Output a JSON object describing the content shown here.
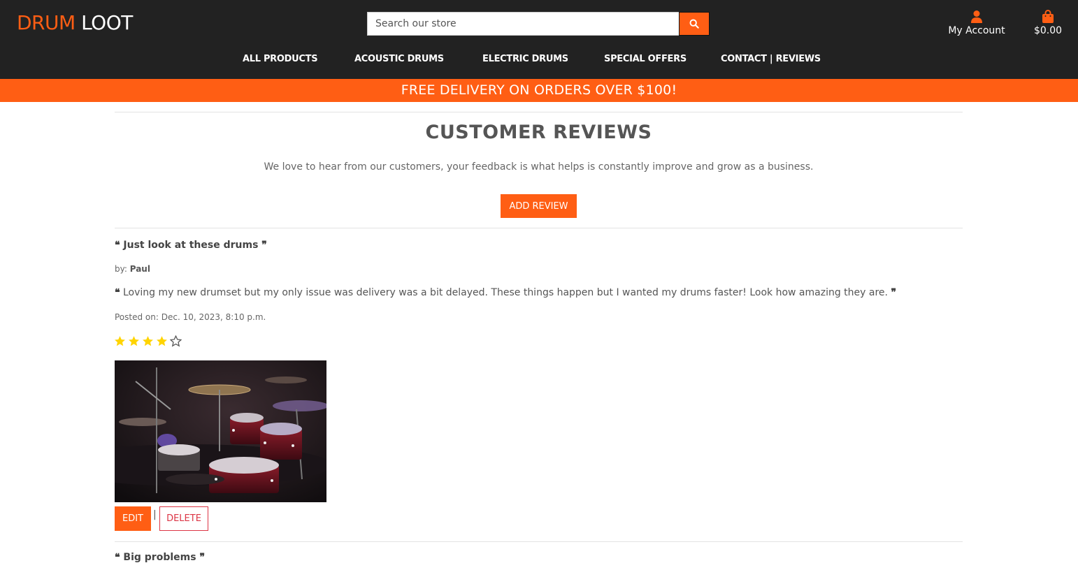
{
  "brand": {
    "part1": "DRUM",
    "part2": "LOOT"
  },
  "search": {
    "placeholder": "Search our store",
    "icon": "search-icon"
  },
  "account": {
    "label": "My Account",
    "icon": "user-icon"
  },
  "cart": {
    "total": "$0.00",
    "icon": "shopping-bag-icon"
  },
  "nav": [
    {
      "label": "ALL PRODUCTS"
    },
    {
      "label": "ACOUSTIC DRUMS"
    },
    {
      "label": "ELECTRIC DRUMS"
    },
    {
      "label": "SPECIAL OFFERS"
    },
    {
      "label": "CONTACT | REVIEWS"
    }
  ],
  "banner": "FREE DELIVERY ON ORDERS OVER $100!",
  "page": {
    "title": "CUSTOMER REVIEWS",
    "intro": "We love to hear from our customers, your feedback is what helps is constantly improve and grow as a business.",
    "add_review": "ADD REVIEW"
  },
  "reviews": [
    {
      "title": "Just look at these drums",
      "by_prefix": "by:",
      "author": "Paul",
      "body": "Loving my new drumset but my only issue was delivery was a bit delayed. These things happen but I wanted my drums faster! Look how amazing they are.",
      "posted": "Posted on: Dec. 10, 2023, 8:10 p.m.",
      "rating": 4,
      "rating_max": 5,
      "image_icon": "drum-kit-photo",
      "edit": "EDIT",
      "separator": "|",
      "delete": "DELETE"
    },
    {
      "title": "Big problems"
    }
  ],
  "colors": {
    "accent": "#ff5e14",
    "header": "#222222",
    "star": "#ffd400",
    "danger": "#dc3545"
  }
}
